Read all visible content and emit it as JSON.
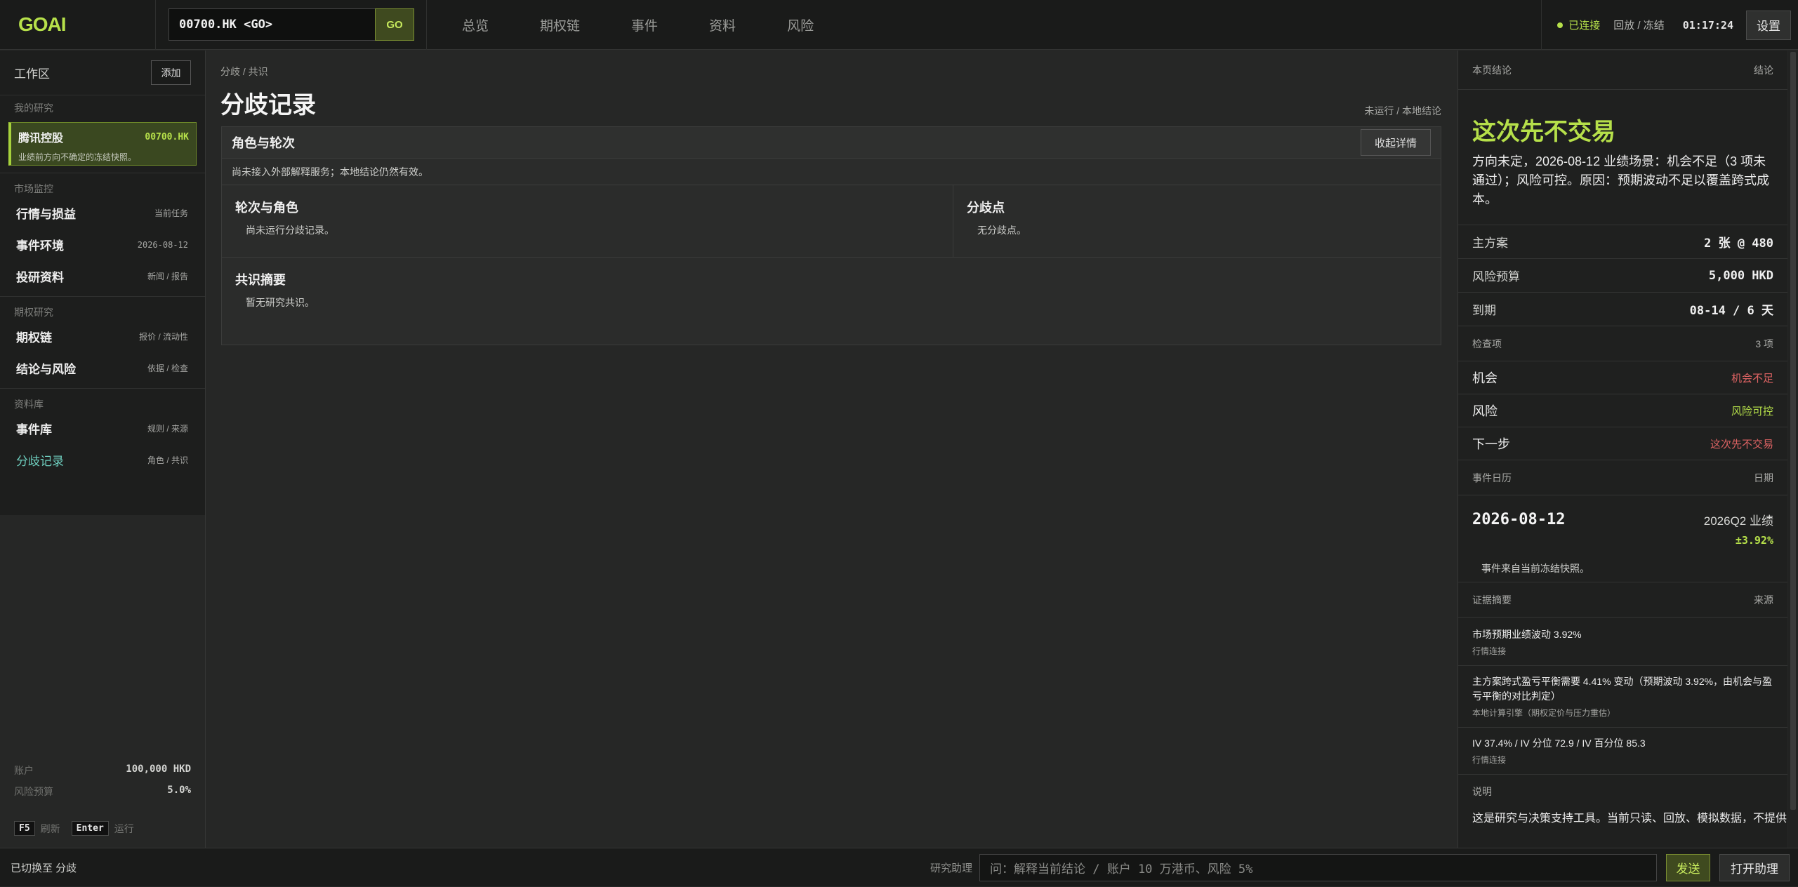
{
  "app": {
    "logo": "GOAI"
  },
  "command": {
    "value": "00700.HK <GO>",
    "go_label": "GO"
  },
  "nav": [
    "总览",
    "期权链",
    "事件",
    "资料",
    "风险"
  ],
  "status": {
    "connection": "已连接",
    "mode": "回放 / 冻结",
    "time": "01:17:24",
    "settings_label": "设置"
  },
  "sidebar": {
    "workspace_title": "工作区",
    "add_label": "添加",
    "my_research_label": "我的研究",
    "research": {
      "name": "腾讯控股",
      "code": "00700.HK",
      "subtitle": "业绩前方向不确定的冻结快照。"
    },
    "groups": [
      {
        "label": "市场监控",
        "items": [
          {
            "label": "行情与损益",
            "meta": "当前任务"
          },
          {
            "label": "事件环境",
            "meta": "2026-08-12"
          },
          {
            "label": "投研资料",
            "meta": "新闻 / 报告"
          }
        ]
      },
      {
        "label": "期权研究",
        "items": [
          {
            "label": "期权链",
            "meta": "报价 / 流动性"
          },
          {
            "label": "结论与风险",
            "meta": "依据 / 检查"
          }
        ]
      },
      {
        "label": "资料库",
        "items": [
          {
            "label": "事件库",
            "meta": "规则 / 来源"
          },
          {
            "label": "分歧记录",
            "meta": "角色 / 共识"
          }
        ]
      }
    ],
    "account": {
      "label": "账户",
      "value": "100,000 HKD"
    },
    "risk_budget": {
      "label": "风险预算",
      "value": "5.0%"
    },
    "keys": [
      {
        "key": "F5",
        "label": "刷新"
      },
      {
        "key": "Enter",
        "label": "运行"
      }
    ]
  },
  "main": {
    "breadcrumb": "分歧 / 共识",
    "title": "分歧记录",
    "status": "未运行 / 本地结论",
    "panel": {
      "title": "角色与轮次",
      "collapse_label": "收起详情",
      "note": "尚未接入外部解释服务；本地结论仍然有效。",
      "rounds": {
        "title": "轮次与角色",
        "body": "尚未运行分歧记录。"
      },
      "divergence": {
        "title": "分歧点",
        "body": "无分歧点。"
      },
      "consensus": {
        "title": "共识摘要",
        "body": "暂无研究共识。"
      }
    }
  },
  "right": {
    "header_label": "本页结论",
    "header_meta": "结论",
    "conclusion_title": "这次先不交易",
    "conclusion_body": "方向未定，2026-08-12 业绩场景：机会不足（3 项未通过）；风险可控。原因：预期波动不足以覆盖跨式成本。",
    "kv": [
      {
        "k": "主方案",
        "v": "2 张 @ 480"
      },
      {
        "k": "风险预算",
        "v": "5,000 HKD"
      },
      {
        "k": "到期",
        "v": "08-14 / 6 天"
      }
    ],
    "checks_label": "检查项",
    "checks_count": "3 项",
    "checks": [
      {
        "k": "机会",
        "v": "机会不足",
        "tone": "red"
      },
      {
        "k": "风险",
        "v": "风险可控",
        "tone": "green"
      },
      {
        "k": "下一步",
        "v": "这次先不交易",
        "tone": "red"
      }
    ],
    "calendar_label": "事件日历",
    "calendar_meta": "日期",
    "event": {
      "date": "2026-08-12",
      "name": "2026Q2 业绩",
      "pct": "±3.92%",
      "note": "事件来自当前冻结快照。"
    },
    "evidence_label": "证据摘要",
    "evidence_meta": "来源",
    "evidence": [
      {
        "text": "市场预期业绩波动 3.92%",
        "source": "行情连接"
      },
      {
        "text": "主方案跨式盈亏平衡需要 4.41% 变动（预期波动 3.92%，由机会与盈亏平衡的对比判定）",
        "source": "本地计算引擎（期权定价与压力重估）"
      },
      {
        "text": "IV 37.4% / IV 分位 72.9 / IV 百分位 85.3",
        "source": "行情连接"
      }
    ],
    "desc_label": "说明",
    "desc_body": "这是研究与决策支持工具。当前只读、回放、模拟数据，不提供"
  },
  "bottom": {
    "status": "已切换至 分歧",
    "assistant_label": "研究助理",
    "input_placeholder": "问：解释当前结论 / 账户 10 万港币、风险 5%",
    "send_label": "发送",
    "open_label": "打开助理"
  }
}
